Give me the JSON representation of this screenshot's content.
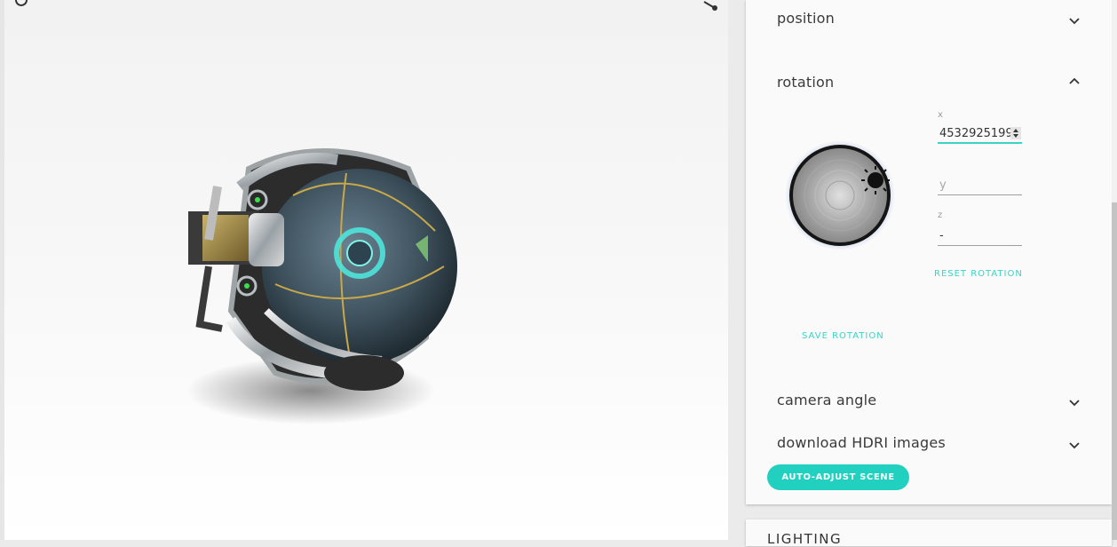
{
  "viewport": {
    "icons": {
      "reload": "reload-icon",
      "share": "share-icon",
      "model": "robot-sphere-model"
    }
  },
  "panel": {
    "sections": {
      "position": {
        "label": "position",
        "state": "collapsed"
      },
      "rotation": {
        "label": "rotation",
        "state": "expanded"
      },
      "camera_angle": {
        "label": "camera angle",
        "state": "collapsed"
      },
      "hdri": {
        "label": "download HDRI images",
        "state": "collapsed"
      }
    },
    "rotation": {
      "x": {
        "label": "x",
        "value": "4532925199"
      },
      "y": {
        "label": "",
        "placeholder": "y",
        "value": ""
      },
      "z": {
        "label": "z",
        "value": "-"
      },
      "reset_label": "RESET ROTATION",
      "save_label": "SAVE ROTATION"
    },
    "auto_adjust_label": "AUTO-ADJUST SCENE"
  },
  "lighting": {
    "label": "LIGHTING"
  },
  "colors": {
    "accent": "#22d0c0",
    "accent_text": "#3ad3c5"
  }
}
